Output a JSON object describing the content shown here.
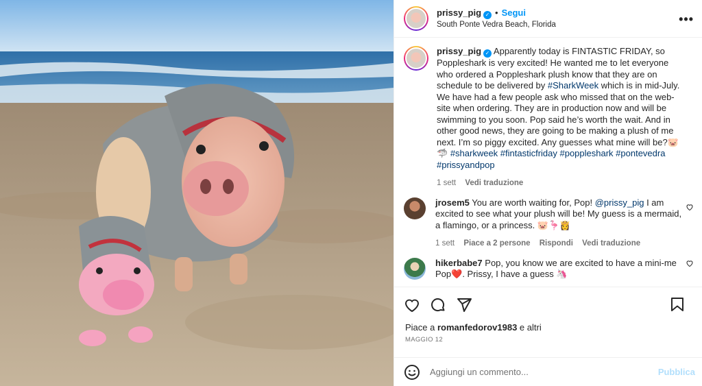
{
  "post": {
    "username": "prissy_pig",
    "follow_label": "Segui",
    "dot": "•",
    "location": "South Ponte Vedra Beach, Florida",
    "more": "•••",
    "verified_mark": "✓"
  },
  "caption": {
    "username": "prissy_pig",
    "text_1": " Apparently today is FINTASTIC FRIDAY, so Poppleshark is very excited! He wanted me to let everyone who ordered a Poppleshark plush know that they are on schedule to be delivered by ",
    "tag_sharkweek": "#SharkWeek",
    "text_2": " which is in mid-July. We have had a few people ask who missed that on the web-site when ordering. They are in production now and will be swimming to you soon. Pop said he’s worth the wait. And in other good news, they are going to be making a plush of me next. I’m so piggy excited. Any guesses what mine will be?🐷🦈 ",
    "hashtags": "#sharkweek #fintasticfriday #poppleshark #pontevedra #prissyandpop",
    "time": "1 sett",
    "translate": "Vedi traduzione"
  },
  "comments": [
    {
      "username": "jrosem5",
      "text_1": " You are worth waiting for, Pop! ",
      "mention": "@prissy_pig",
      "text_2": " I am excited to see what your plush will be! My guess is a mermaid, a flamingo, or a princess. 🐷🦩👸",
      "time": "1 sett",
      "likes": "Piace a 2 persone",
      "reply": "Rispondi",
      "translate": "Vedi traduzione"
    },
    {
      "username": "hikerbabe7",
      "text": " Pop, you know we are excited to have a mini-me Pop❤️. Prissy, I have a guess 🦄"
    }
  ],
  "likes_bar": {
    "prefix": "Piace a ",
    "user": "romanfedorov1983",
    "suffix": " e altri",
    "date": "MAGGIO 12"
  },
  "comment_box": {
    "placeholder": "Aggiungi un commento...",
    "post_label": "Pubblica"
  },
  "icons": {
    "like": "heart-icon",
    "comment": "comment-icon",
    "share": "send-icon",
    "save": "bookmark-icon",
    "emoji": "emoji-icon"
  },
  "colors": {
    "accent": "#0095f6",
    "link": "#00376b",
    "muted": "#737373",
    "post_disabled": "#b2dffc"
  }
}
